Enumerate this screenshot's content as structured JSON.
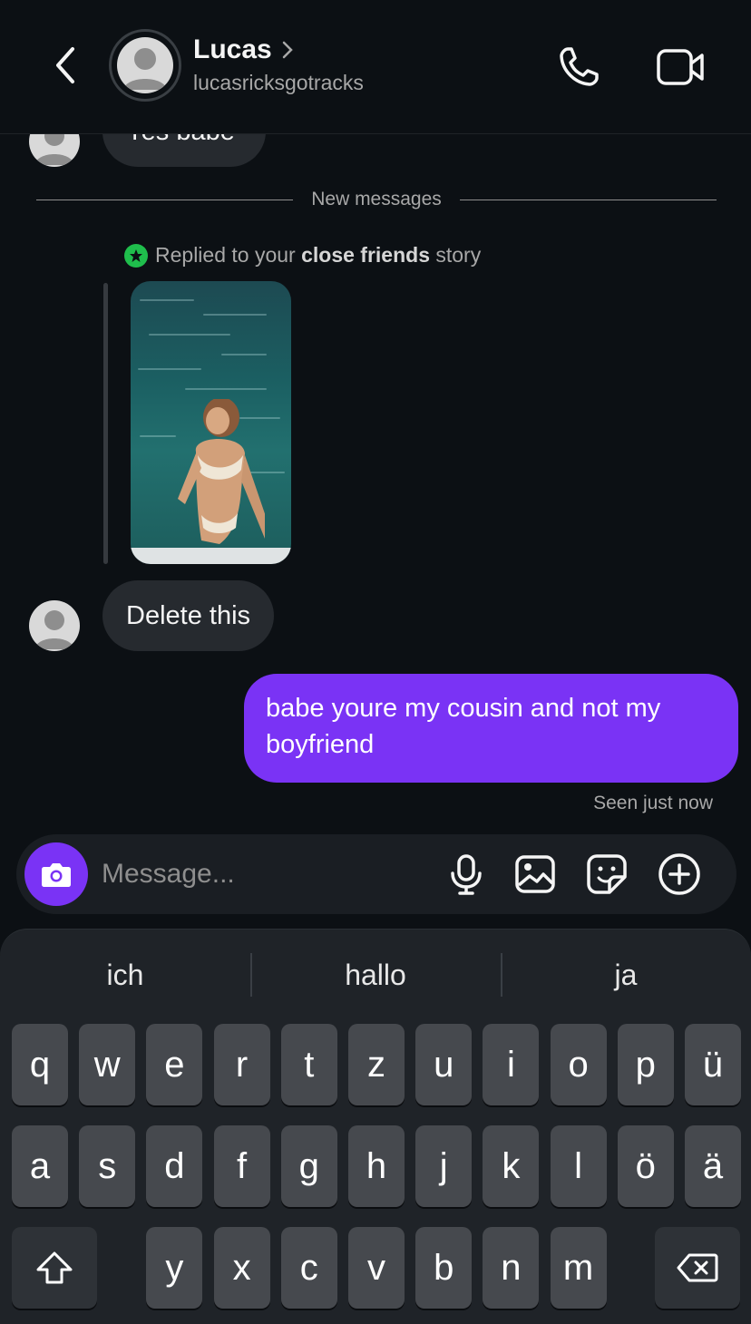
{
  "header": {
    "back_icon": "chevron-left-icon",
    "name": "Lucas",
    "name_chevron": "›",
    "username": "lucasricksgotracks",
    "call_icon": "phone-icon",
    "video_icon": "video-camera-icon"
  },
  "messages": {
    "previous_partial": "Yes babe",
    "divider_label": "New messages",
    "story_reply": {
      "prefix": "Replied to your ",
      "bold": "close friends",
      "suffix": " story"
    },
    "incoming": "Delete this",
    "outgoing": "babe youre my cousin and not my boyfriend",
    "seen": "Seen just now"
  },
  "composer": {
    "placeholder": "Message...",
    "icons": [
      "camera-icon",
      "microphone-icon",
      "gallery-icon",
      "sticker-icon",
      "plus-circle-icon"
    ]
  },
  "keyboard": {
    "suggestions": [
      "ich",
      "hallo",
      "ja"
    ],
    "row1": [
      "q",
      "w",
      "e",
      "r",
      "t",
      "z",
      "u",
      "i",
      "o",
      "p",
      "ü"
    ],
    "row2": [
      "a",
      "s",
      "d",
      "f",
      "g",
      "h",
      "j",
      "k",
      "l",
      "ö",
      "ä"
    ],
    "row3": [
      "y",
      "x",
      "c",
      "v",
      "b",
      "n",
      "m"
    ],
    "shift_icon": "shift-icon",
    "backspace_icon": "backspace-icon"
  },
  "colors": {
    "background": "#0c1014",
    "outgoing_bubble": "#7a33f5",
    "incoming_bubble": "#262a2f",
    "close_friends_green": "#1fbe4c"
  }
}
